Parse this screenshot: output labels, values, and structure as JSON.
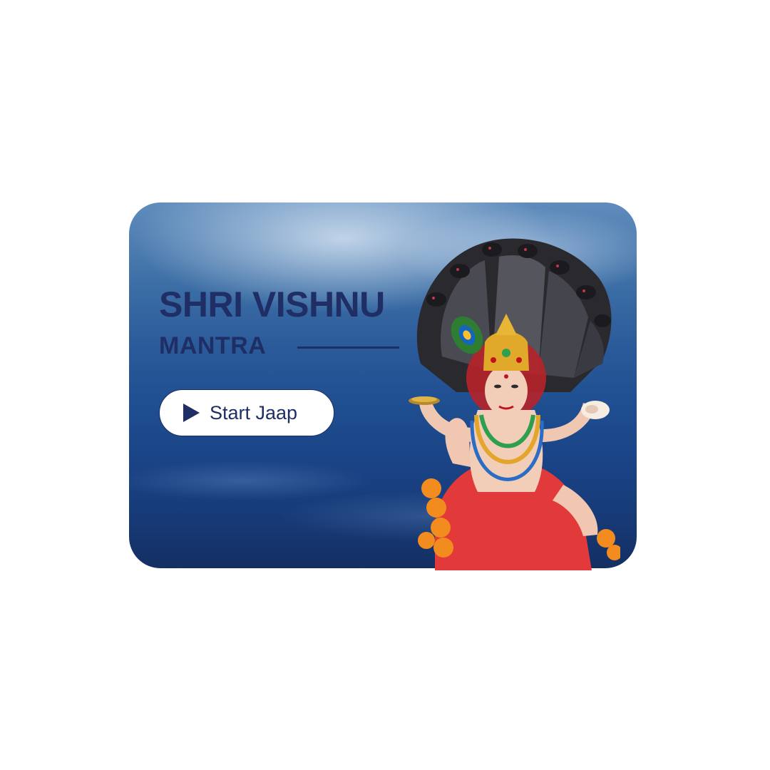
{
  "card": {
    "title_line1": "SHRI VISHNU",
    "title_line2": "MANTRA",
    "start_button_label": "Start Jaap",
    "play_icon": "play-icon",
    "image": "vishnu-idol-illustration"
  },
  "colors": {
    "title": "#1f2f66",
    "card_sky": "#5f8cbc",
    "card_sea": "#173b78",
    "button_bg": "#ffffff"
  }
}
